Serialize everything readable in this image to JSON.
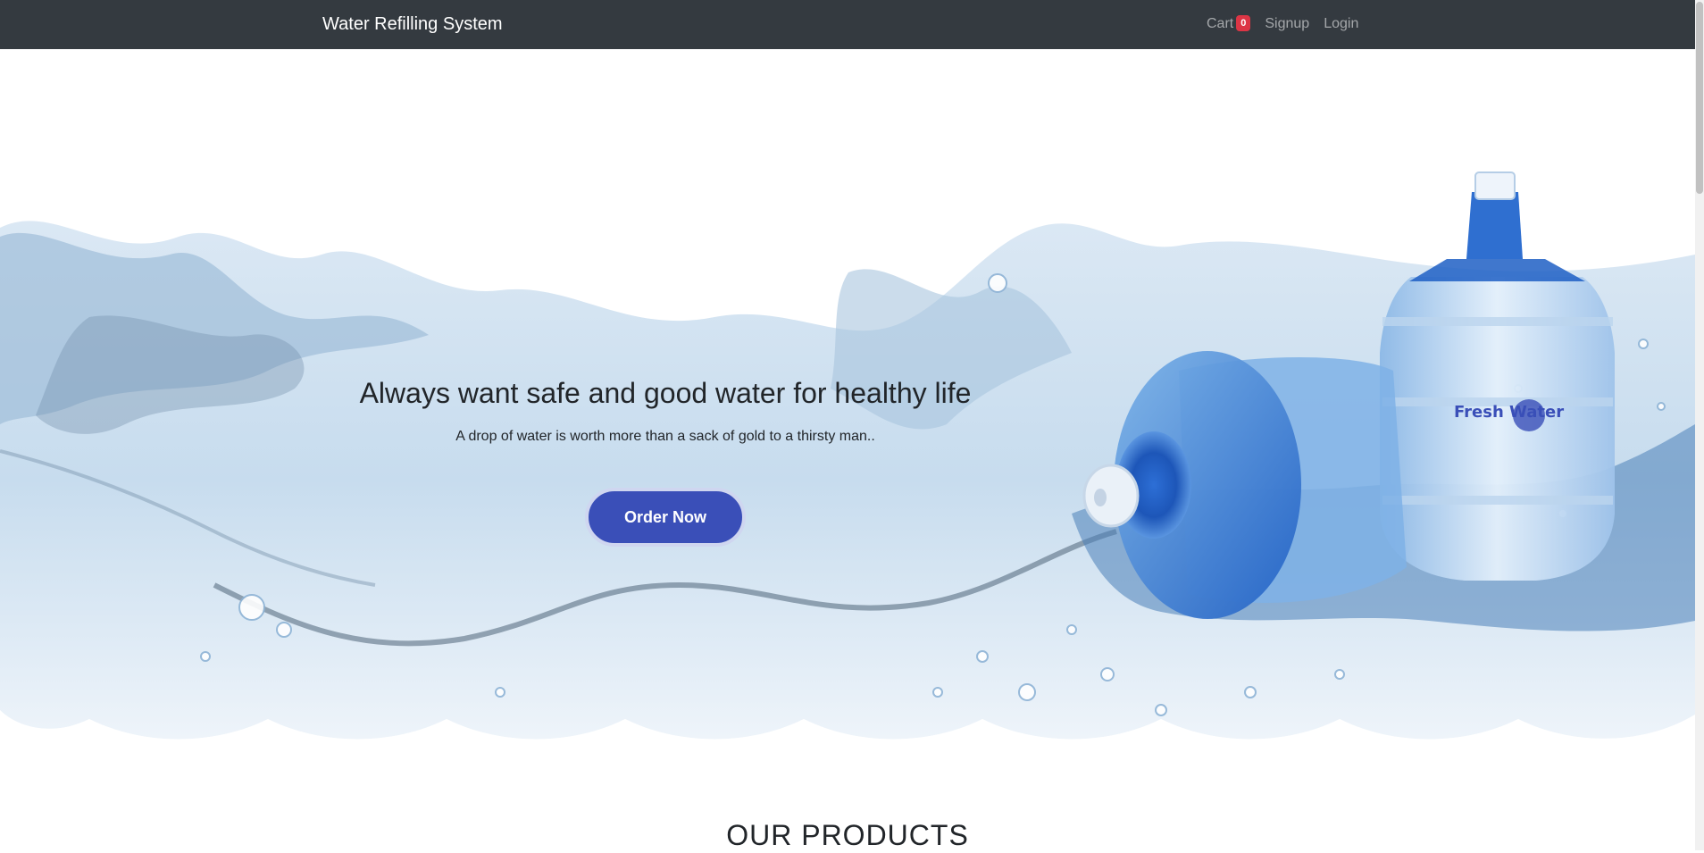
{
  "navbar": {
    "brand": "Water Refilling System",
    "cart_label": "Cart",
    "cart_count": "0",
    "signup_label": "Signup",
    "login_label": "Login"
  },
  "hero": {
    "title": "Always want safe and good water for healthy life",
    "subtitle": "A drop of water is worth more than a sack of gold to a thirsty man..",
    "order_button_label": "Order Now",
    "bottle_logo_text": "Fresh Water"
  },
  "products": {
    "heading": "OUR PRODUCTS"
  },
  "colors": {
    "navbar_bg": "#343a40",
    "accent": "#3a4fb8",
    "badge": "#dc3545",
    "water": "#5a9fd8"
  }
}
